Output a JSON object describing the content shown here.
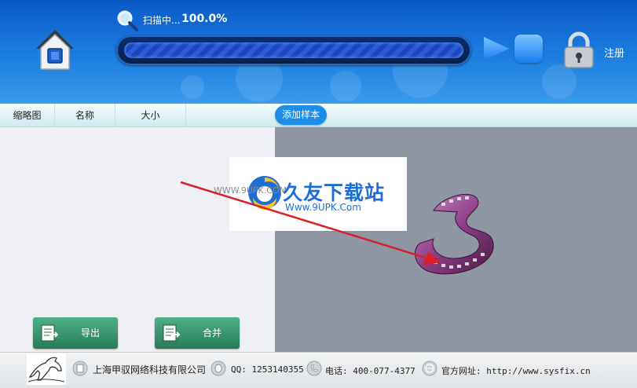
{
  "header": {
    "scan_status": "扫描中...",
    "scan_percent": "100.0%",
    "progress": 1.0,
    "register_label": "注册",
    "icons": {
      "home": "home-icon",
      "search": "search-icon",
      "play": "play-icon",
      "stop": "stop-icon",
      "lock": "lock-icon"
    }
  },
  "columns": [
    "缩略图",
    "名称",
    "大小"
  ],
  "add_sample_label": "添加样本",
  "actions": {
    "export_label": "导出",
    "merge_label": "合并"
  },
  "watermark": {
    "title": "久友下载站",
    "url": "Www.9UPK.Com",
    "small": "WWW.9UPK.COM"
  },
  "footer": {
    "company": "上海甲驭网络科技有限公司",
    "qq": "QQ: 1253140355",
    "phone": "电话: 400-077-4377",
    "website": "官方网址: http://www.sysfix.cn"
  },
  "colors": {
    "header_blue": "#1c7fe0",
    "action_green": "#267a58",
    "add_sample_blue": "#1a8ee8",
    "preview_gray": "#8f96a3",
    "arrow_red": "#d8202a"
  }
}
